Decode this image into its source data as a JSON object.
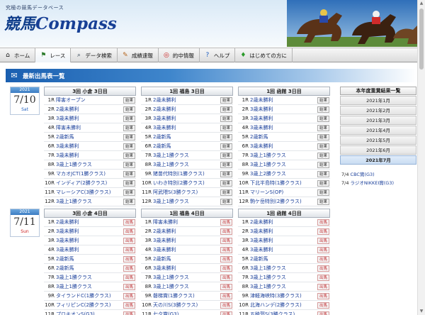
{
  "header": {
    "tagline": "究極の競馬データベース",
    "logo_jp": "競馬",
    "logo_en": "Compass"
  },
  "nav": [
    {
      "label": "ホーム",
      "icon": "home-icon"
    },
    {
      "label": "レース",
      "icon": "flag-icon"
    },
    {
      "label": "データ検索",
      "icon": "search-icon"
    },
    {
      "label": "成績速報",
      "icon": "clipboard-icon"
    },
    {
      "label": "的中情報",
      "icon": "target-icon"
    },
    {
      "label": "ヘルプ",
      "icon": "help-icon"
    },
    {
      "label": "はじめての方に",
      "icon": "beginner-icon"
    }
  ],
  "section_title": "最新出馬表一覧",
  "days": [
    {
      "year": "2021",
      "date": "7/10",
      "dow": "Sat",
      "venues": [
        {
          "name": "3回 小倉 3日目",
          "races": [
            {
              "no": "1R",
              "name": "障害オープン",
              "btn": "結果"
            },
            {
              "no": "2R",
              "name": "2歳未勝利",
              "btn": "結果"
            },
            {
              "no": "3R",
              "name": "3歳未勝利",
              "btn": "結果"
            },
            {
              "no": "4R",
              "name": "障害未勝利",
              "btn": "結果"
            },
            {
              "no": "5R",
              "name": "2歳新馬",
              "btn": "結果"
            },
            {
              "no": "6R",
              "name": "3歳未勝利",
              "btn": "結果"
            },
            {
              "no": "7R",
              "name": "3歳未勝利",
              "btn": "結果"
            },
            {
              "no": "8R",
              "name": "3歳上1勝クラス",
              "btn": "結果"
            },
            {
              "no": "9R",
              "name": "マカオJCT(1勝クラス)",
              "btn": "結果"
            },
            {
              "no": "10R",
              "name": "インディア(2勝クラス)",
              "btn": "結果"
            },
            {
              "no": "11R",
              "name": "マレーシアC(3勝クラス)",
              "btn": "結果"
            },
            {
              "no": "12R",
              "name": "3歳上1勝クラス",
              "btn": "結果"
            }
          ]
        },
        {
          "name": "1回 福島 3日目",
          "races": [
            {
              "no": "1R",
              "name": "2歳未勝利",
              "btn": "結果"
            },
            {
              "no": "2R",
              "name": "2歳未勝利",
              "btn": "結果"
            },
            {
              "no": "3R",
              "name": "3歳未勝利",
              "btn": "結果"
            },
            {
              "no": "4R",
              "name": "3歳未勝利",
              "btn": "結果"
            },
            {
              "no": "5R",
              "name": "2歳新馬",
              "btn": "結果"
            },
            {
              "no": "6R",
              "name": "2歳新馬",
              "btn": "結果"
            },
            {
              "no": "7R",
              "name": "3歳上1勝クラス",
              "btn": "結果"
            },
            {
              "no": "8R",
              "name": "3歳上1勝クラス",
              "btn": "結果"
            },
            {
              "no": "9R",
              "name": "猪苗代特別(1勝クラス)",
              "btn": "結果"
            },
            {
              "no": "10R",
              "name": "いわき特別(2勝クラス)",
              "btn": "結果"
            },
            {
              "no": "11R",
              "name": "阿武隈S(3勝クラス)",
              "btn": "結果"
            },
            {
              "no": "12R",
              "name": "3歳上1勝クラス",
              "btn": "結果"
            }
          ]
        },
        {
          "name": "1回 函館 3日目",
          "races": [
            {
              "no": "1R",
              "name": "2歳未勝利",
              "btn": "結果"
            },
            {
              "no": "2R",
              "name": "3歳未勝利",
              "btn": "結果"
            },
            {
              "no": "3R",
              "name": "3歳未勝利",
              "btn": "結果"
            },
            {
              "no": "4R",
              "name": "3歳未勝利",
              "btn": "結果"
            },
            {
              "no": "5R",
              "name": "2歳新馬",
              "btn": "結果"
            },
            {
              "no": "6R",
              "name": "3歳未勝利",
              "btn": "結果"
            },
            {
              "no": "7R",
              "name": "3歳上1勝クラス",
              "btn": "結果"
            },
            {
              "no": "8R",
              "name": "3歳上1勝クラス",
              "btn": "結果"
            },
            {
              "no": "9R",
              "name": "3歳上2勝クラス",
              "btn": "結果"
            },
            {
              "no": "10R",
              "name": "下北半島特(1勝クラス)",
              "btn": "結果"
            },
            {
              "no": "11R",
              "name": "マリーンS(OP)",
              "btn": "結果"
            },
            {
              "no": "12R",
              "name": "駒ケ岳特別(2勝クラス)",
              "btn": "結果"
            }
          ]
        }
      ]
    },
    {
      "year": "2021",
      "date": "7/11",
      "dow": "Sun",
      "venues": [
        {
          "name": "3回 小倉 4日目",
          "races": [
            {
              "no": "1R",
              "name": "2歳未勝利",
              "btn": "出馬"
            },
            {
              "no": "2R",
              "name": "3歳未勝利",
              "btn": "出馬"
            },
            {
              "no": "3R",
              "name": "3歳未勝利",
              "btn": "出馬"
            },
            {
              "no": "4R",
              "name": "3歳未勝利",
              "btn": "出馬"
            },
            {
              "no": "5R",
              "name": "2歳新馬",
              "btn": "出馬"
            },
            {
              "no": "6R",
              "name": "2歳新馬",
              "btn": "出馬"
            },
            {
              "no": "7R",
              "name": "3歳上1勝クラス",
              "btn": "出馬"
            },
            {
              "no": "8R",
              "name": "3歳上1勝クラス",
              "btn": "出馬"
            },
            {
              "no": "9R",
              "name": "タイランドC(1勝クラス)",
              "btn": "出馬"
            },
            {
              "no": "10R",
              "name": "フィリピンC(2勝クラス)",
              "btn": "出馬"
            },
            {
              "no": "11R",
              "name": "プロキオンS(G3)",
              "btn": "出馬"
            }
          ]
        },
        {
          "name": "1回 福島 4日目",
          "races": [
            {
              "no": "1R",
              "name": "障害未勝利",
              "btn": "出馬"
            },
            {
              "no": "2R",
              "name": "2歳未勝利",
              "btn": "出馬"
            },
            {
              "no": "3R",
              "name": "3歳未勝利",
              "btn": "出馬"
            },
            {
              "no": "4R",
              "name": "3歳未勝利",
              "btn": "出馬"
            },
            {
              "no": "5R",
              "name": "2歳新馬",
              "btn": "出馬"
            },
            {
              "no": "6R",
              "name": "3歳未勝利",
              "btn": "出馬"
            },
            {
              "no": "7R",
              "name": "3歳上1勝クラス",
              "btn": "出馬"
            },
            {
              "no": "8R",
              "name": "3歳上1勝クラス",
              "btn": "出馬"
            },
            {
              "no": "9R",
              "name": "磐梯賞(1勝クラス)",
              "btn": "出馬"
            },
            {
              "no": "10R",
              "name": "天の川S(3勝クラス)",
              "btn": "出馬"
            },
            {
              "no": "11R",
              "name": "七夕賞(G3)",
              "btn": "出馬"
            }
          ]
        },
        {
          "name": "1回 函館 4日目",
          "races": [
            {
              "no": "1R",
              "name": "2歳未勝利",
              "btn": "出馬"
            },
            {
              "no": "2R",
              "name": "3歳未勝利",
              "btn": "出馬"
            },
            {
              "no": "3R",
              "name": "3歳未勝利",
              "btn": "出馬"
            },
            {
              "no": "4R",
              "name": "3歳未勝利",
              "btn": "出馬"
            },
            {
              "no": "5R",
              "name": "2歳新馬",
              "btn": "出馬"
            },
            {
              "no": "6R",
              "name": "3歳上1勝クラス",
              "btn": "出馬"
            },
            {
              "no": "7R",
              "name": "3歳上1勝クラス",
              "btn": "出馬"
            },
            {
              "no": "8R",
              "name": "3歳上1勝クラス",
              "btn": "出馬"
            },
            {
              "no": "9R",
              "name": "津軽海峡特(3勝クラス)",
              "btn": "出馬"
            },
            {
              "no": "10R",
              "name": "北海ハンデ(2勝クラス)",
              "btn": "出馬"
            },
            {
              "no": "11R",
              "name": "五稜郭S(3勝クラス)",
              "btn": "出馬"
            }
          ]
        }
      ]
    }
  ],
  "results": {
    "title": "本年度重賞結果一覧",
    "months": [
      "2021年1月",
      "2021年2月",
      "2021年3月",
      "2021年4月",
      "2021年5月",
      "2021年6月",
      "2021年7月"
    ],
    "selected_month": "2021年7月",
    "items": [
      {
        "date": "7/4",
        "name": "CBC賞(G3)"
      },
      {
        "date": "7/4",
        "name": "ラジオNIKKEI賞(G3)"
      }
    ]
  },
  "colors": {
    "accent": "#1a5fb0",
    "link": "#1a3f9a",
    "saturday": "#2060c0",
    "sunday": "#cc2020"
  }
}
